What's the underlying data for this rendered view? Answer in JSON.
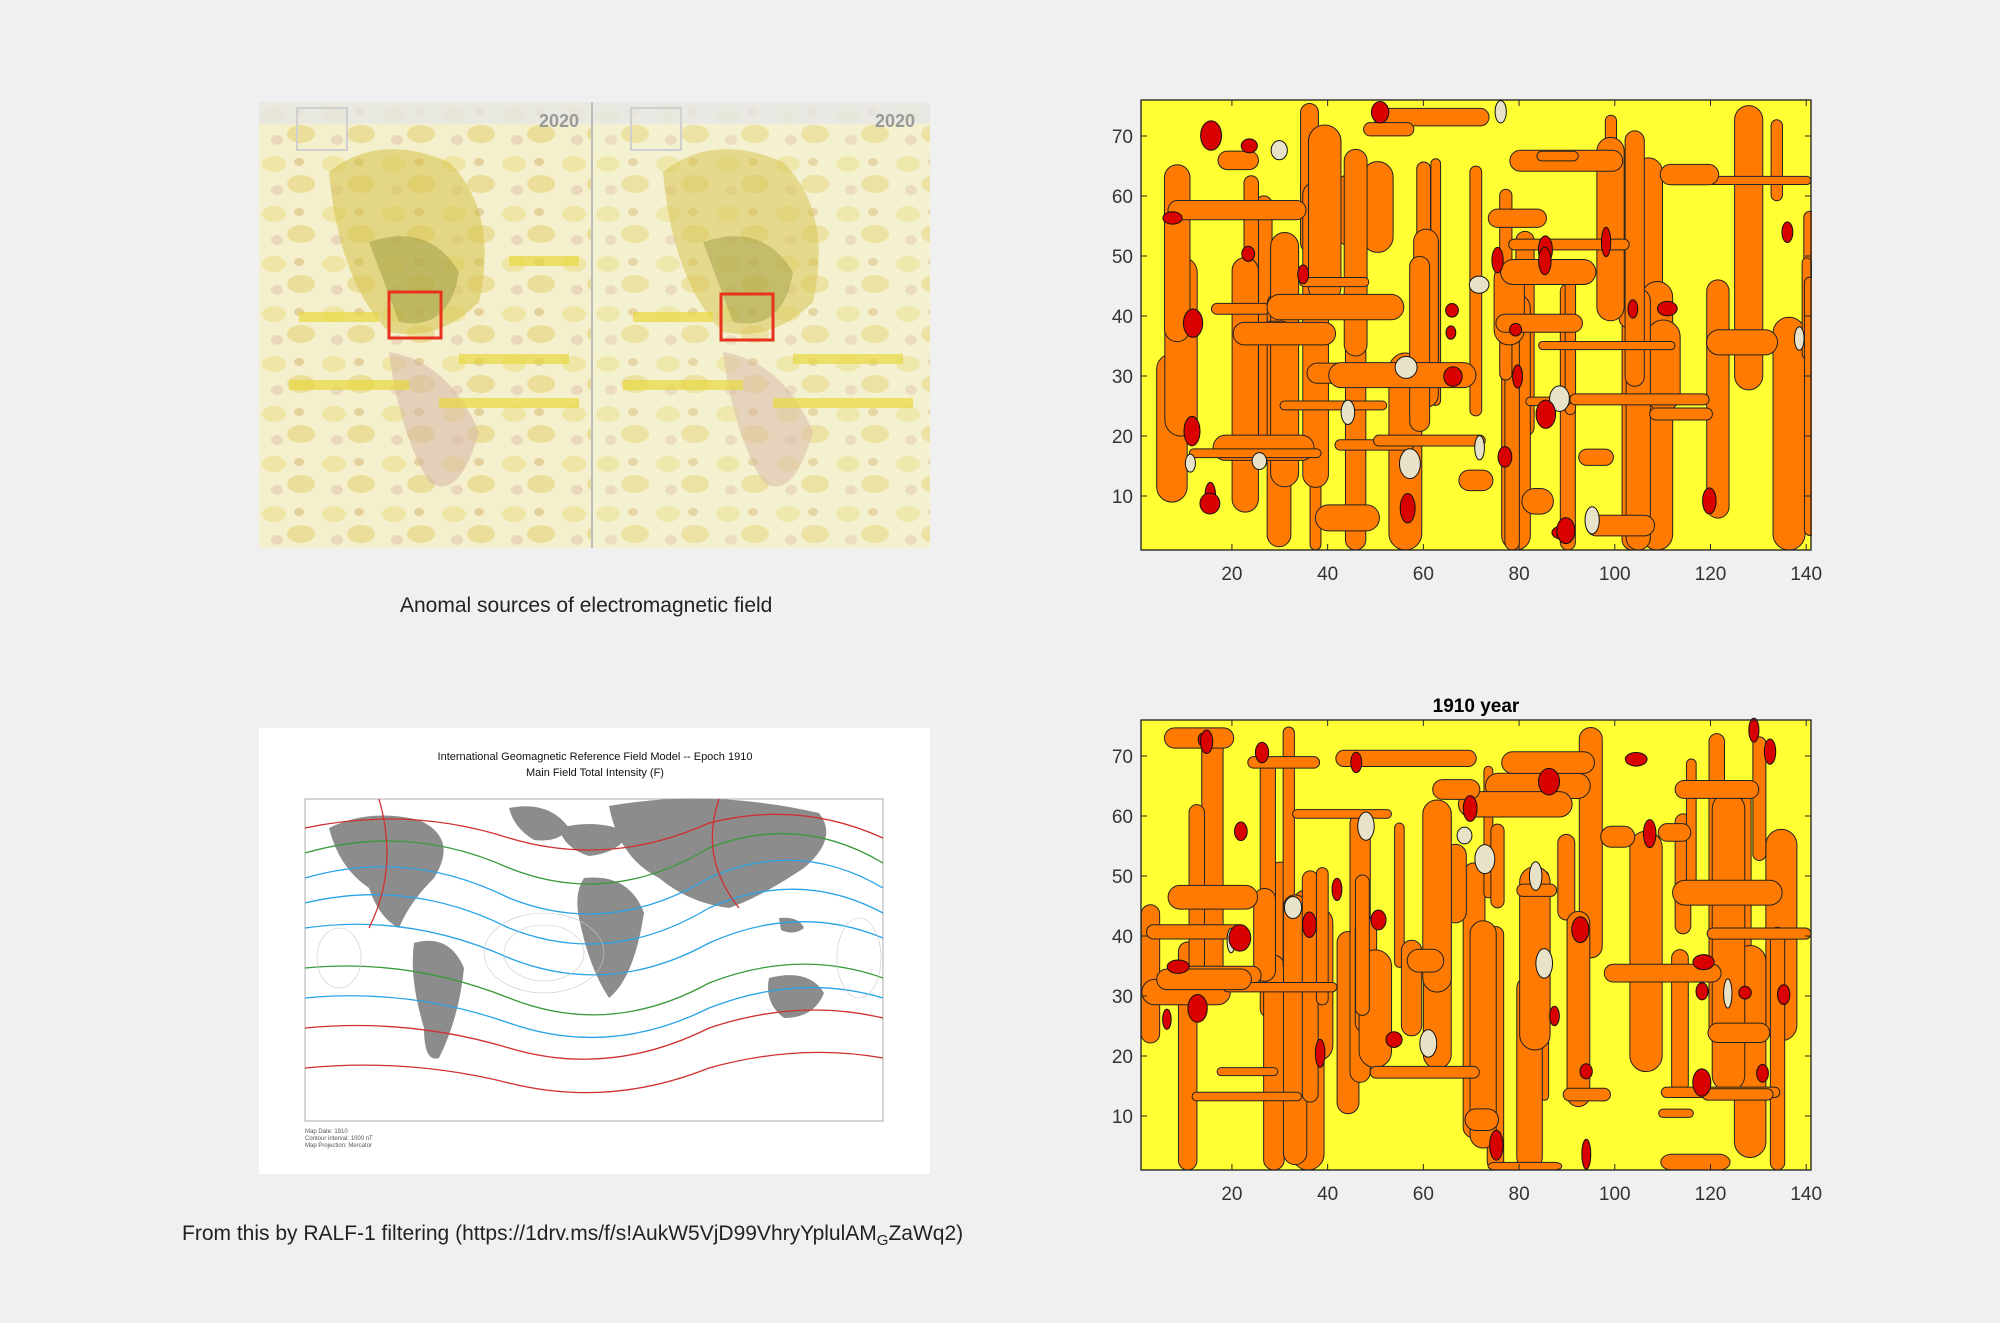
{
  "top_left_image": {
    "year_label_left": "2020",
    "year_label_right": "2020",
    "caption": "Anomal sources of electromagnetic field"
  },
  "bottom_left_image": {
    "map_title_line1": "International Geomagnetic Reference Field Model --  Epoch 1910",
    "map_title_line2": "Main Field Total Intensity (F)",
    "caption_main": "From this by RALF-1 filtering (https://1drv.ms/f/s!AukW5VjD99VhryYplulAM",
    "caption_subscript": "G",
    "caption_tail": "ZaWq2)"
  },
  "colors": {
    "background": "#f0f0f0",
    "contour_yellow": "#ffff33",
    "contour_orange": "#ff7a00",
    "contour_red": "#d90000",
    "contour_light": "#e8e3c8",
    "highlight_box": "#e8321e"
  },
  "chart_data": [
    {
      "type": "heatmap",
      "title": "",
      "xlim": [
        1,
        141
      ],
      "ylim": [
        1,
        76
      ],
      "x_ticks": [
        "20",
        "40",
        "60",
        "80",
        "100",
        "120",
        "140"
      ],
      "y_ticks": [
        "10",
        "20",
        "30",
        "40",
        "50",
        "60",
        "70"
      ],
      "levels": [
        "yellow",
        "orange",
        "red",
        "pale"
      ]
    },
    {
      "type": "heatmap",
      "title": "1910  year",
      "xlim": [
        1,
        141
      ],
      "ylim": [
        1,
        76
      ],
      "x_ticks": [
        "20",
        "40",
        "60",
        "80",
        "100",
        "120",
        "140"
      ],
      "y_ticks": [
        "10",
        "20",
        "30",
        "40",
        "50",
        "60",
        "70"
      ],
      "levels": [
        "yellow",
        "orange",
        "red",
        "pale"
      ]
    }
  ]
}
